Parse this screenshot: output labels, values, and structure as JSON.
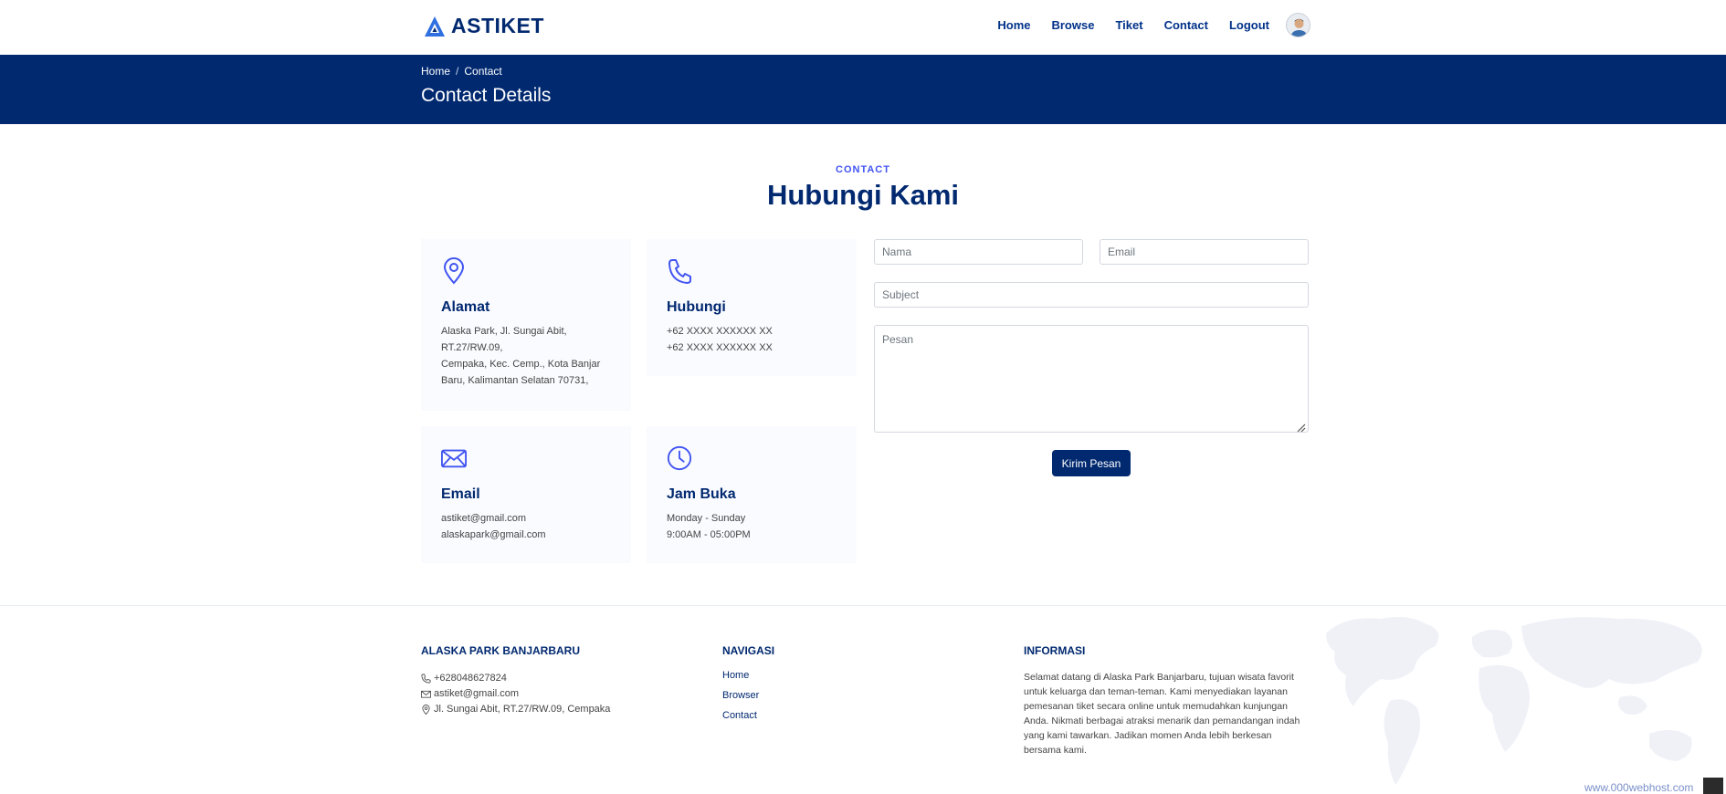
{
  "brand": {
    "name": "ASTIKET",
    "accent": "#012970",
    "link_blue": "#4154f1"
  },
  "nav": {
    "items": [
      {
        "label": "Home"
      },
      {
        "label": "Browse"
      },
      {
        "label": "Tiket"
      },
      {
        "label": "Contact"
      },
      {
        "label": "Logout"
      }
    ],
    "avatar_icon": "user-avatar"
  },
  "breadcrumb": {
    "home": "Home",
    "separator": "/",
    "current": "Contact"
  },
  "page_title": "Contact Details",
  "section": {
    "tag": "CONTACT",
    "title": "Hubungi Kami"
  },
  "info": {
    "address": {
      "icon": "map-pin-icon",
      "title": "Alamat",
      "lines": [
        "Alaska Park, Jl. Sungai Abit,",
        "RT.27/RW.09,",
        "Cempaka, Kec. Cemp., Kota Banjar",
        "Baru, Kalimantan Selatan 70731,"
      ]
    },
    "phone": {
      "icon": "phone-icon",
      "title": "Hubungi",
      "lines": [
        "+62 XXXX XXXXXX XX",
        "+62 XXXX XXXXXX XX"
      ]
    },
    "email": {
      "icon": "envelope-icon",
      "title": "Email",
      "lines": [
        "astiket@gmail.com",
        "alaskapark@gmail.com"
      ]
    },
    "hours": {
      "icon": "clock-icon",
      "title": "Jam Buka",
      "lines": [
        "Monday - Sunday",
        "9:00AM - 05:00PM"
      ]
    }
  },
  "form": {
    "name_placeholder": "Nama",
    "name_value": "",
    "email_placeholder": "Email",
    "email_value": "",
    "subject_placeholder": "Subject",
    "subject_value": "",
    "message_placeholder": "Pesan",
    "message_value": "",
    "submit_label": "Kirim Pesan"
  },
  "footer": {
    "about": {
      "title": "ALASKA PARK BANJARBARU",
      "phone": "+628048627824",
      "email": "astiket@gmail.com",
      "address": "Jl. Sungai Abit, RT.27/RW.09, Cempaka"
    },
    "navigation": {
      "title": "NAVIGASI",
      "links": [
        "Home",
        "Browser",
        "Contact"
      ]
    },
    "information": {
      "title": "INFORMASI",
      "text": "Selamat datang di Alaska Park Banjarbaru, tujuan wisata favorit untuk keluarga dan teman-teman. Kami menyediakan layanan pemesanan tiket secara online untuk memudahkan kunjungan Anda. Nikmati berbagai atraksi menarik dan pemandangan indah yang kami tawarkan. Jadikan momen Anda lebih berkesan bersama kami."
    }
  },
  "watermark": "www.000webhost.com"
}
